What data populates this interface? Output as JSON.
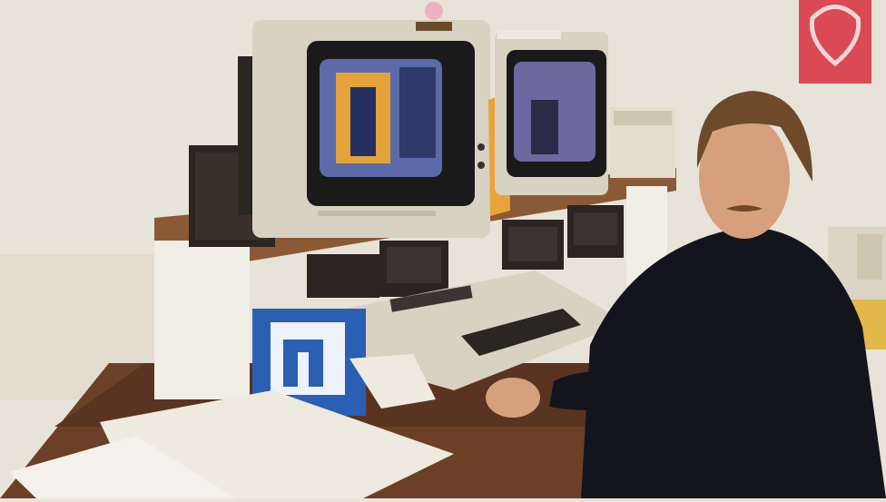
{
  "scene": {
    "colors": {
      "wall": "#e8e3d8",
      "wall_shadow": "#d9d2c4",
      "desk_wood": "#6b4026",
      "shelf_wood": "#8a5a36",
      "beige_plastic": "#d8d2c2",
      "dark_case": "#2b2420",
      "screen_glow": "#5b6aa8",
      "poster_red": "#d94a55",
      "shirt": "#14151c",
      "skin": "#d6a07c",
      "hair": "#6e4a2a",
      "floppy_box": "#2a5fb3",
      "folder_yellow": "#e8a43a",
      "paper": "#eeeae0"
    },
    "icons": [
      "crt-monitor",
      "keyboard",
      "floppy-drive",
      "floppy-disk-box",
      "speaker",
      "telephone",
      "poster"
    ]
  }
}
